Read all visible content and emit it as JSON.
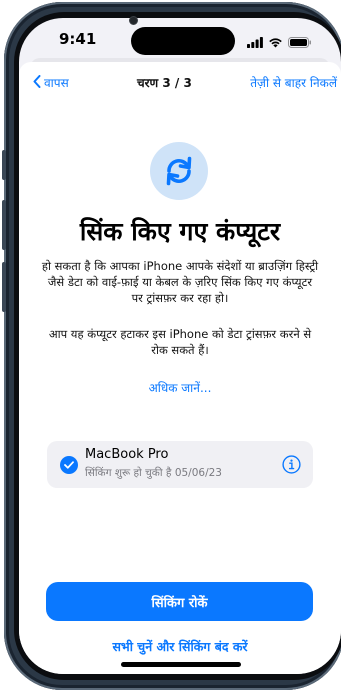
{
  "status_bar": {
    "time": "9:41"
  },
  "nav": {
    "back_label": "वापस",
    "step_label": "चरण 3 / 3",
    "skip_label": "तेज़ी से बाहर निकलें"
  },
  "icons": {
    "sync": "sync-arrows-icon",
    "back": "chevron-left-icon",
    "check": "checkmark-icon",
    "info": "info-icon",
    "signal": "cellular-signal-icon",
    "wifi": "wifi-icon",
    "battery": "battery-icon"
  },
  "main": {
    "title": "सिंक किए गए कंप्यूटर",
    "paragraph_1": "हो सकता है कि आपका iPhone आपके संदेशों या ब्राउज़िंग हिस्ट्री जैसे डेटा को वाई-फ़ाई या केबल के ज़रिए सिंक किए गए कंप्यूटर पर ट्रांसफ़र कर रहा हो।",
    "paragraph_2": "आप यह कंप्यूटर हटाकर इस iPhone को डेटा ट्रांसफ़र करने से रोक सकते हैं।",
    "learn_more": "अधिक जानें..."
  },
  "device": {
    "name": "MacBook Pro",
    "status": "सिंकिंग शुरू हो चुकी है 05/06/23",
    "selected": true
  },
  "actions": {
    "primary": "सिंकिंग रोकें",
    "secondary": "सभी चुनें और सिंकिंग बंद करें"
  },
  "colors": {
    "accent": "#0a78ff",
    "icon_circle": "#cfe3f8",
    "card_bg": "#f0f0f4"
  }
}
